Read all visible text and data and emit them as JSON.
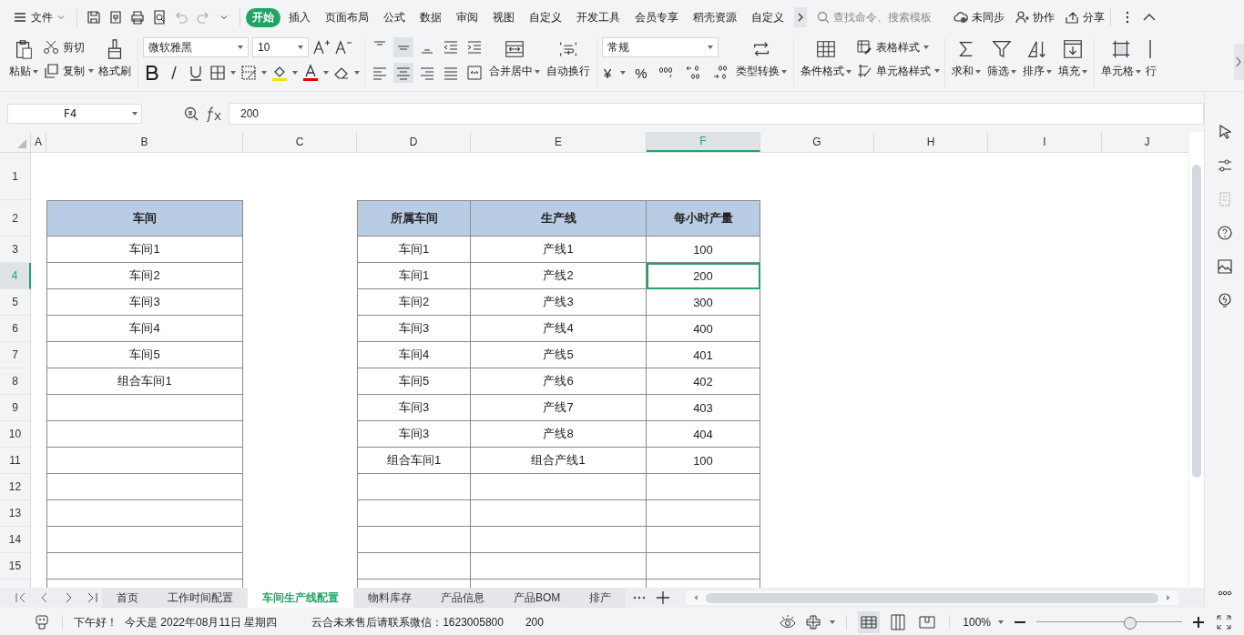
{
  "menu_bar": {
    "file_menu": "文件",
    "tabs": [
      {
        "label": "开始",
        "selected": true
      },
      {
        "label": "插入",
        "selected": false
      },
      {
        "label": "页面布局",
        "selected": false
      },
      {
        "label": "公式",
        "selected": false
      },
      {
        "label": "数据",
        "selected": false
      },
      {
        "label": "审阅",
        "selected": false
      },
      {
        "label": "视图",
        "selected": false
      },
      {
        "label": "自定义",
        "selected": false
      },
      {
        "label": "开发工具",
        "selected": false
      },
      {
        "label": "会员专享",
        "selected": false
      },
      {
        "label": "稻壳资源",
        "selected": false
      },
      {
        "label": "自定义",
        "selected": false
      }
    ],
    "search": {
      "placeholder": "查找命令、搜索模板"
    },
    "sync": "未同步",
    "collaborate": "协作",
    "share": "分享"
  },
  "ribbon": {
    "paste": "粘贴",
    "cut": "剪切",
    "copy": "复制",
    "format_painter": "格式刷",
    "font_name": "微软雅黑",
    "font_size": "10",
    "merge_center": "合并居中",
    "wrap_text": "自动换行",
    "number_format": "常规",
    "currency": "¥",
    "percent": "%",
    "type_convert": "类型转换",
    "conditional_format": "条件格式",
    "table_style": "表格样式",
    "cell_style": "单元格样式",
    "sum": "求和",
    "filter": "筛选",
    "sort": "排序",
    "fill": "填充",
    "cell": "单元格",
    "row": "行"
  },
  "formula_bar": {
    "name_box": "F4",
    "formula": "200"
  },
  "sheet": {
    "columns": [
      {
        "label": "A",
        "selected": false
      },
      {
        "label": "B",
        "selected": false
      },
      {
        "label": "C",
        "selected": false
      },
      {
        "label": "D",
        "selected": false
      },
      {
        "label": "E",
        "selected": false
      },
      {
        "label": "F",
        "selected": true
      },
      {
        "label": "G",
        "selected": false
      },
      {
        "label": "H",
        "selected": false
      },
      {
        "label": "I",
        "selected": false
      },
      {
        "label": "J",
        "selected": false
      }
    ],
    "rows": [
      {
        "label": "1",
        "selected": false
      },
      {
        "label": "2",
        "selected": false
      },
      {
        "label": "3",
        "selected": false
      },
      {
        "label": "4",
        "selected": true
      },
      {
        "label": "5",
        "selected": false
      },
      {
        "label": "6",
        "selected": false
      },
      {
        "label": "7",
        "selected": false
      },
      {
        "label": "8",
        "selected": false
      },
      {
        "label": "9",
        "selected": false
      },
      {
        "label": "10",
        "selected": false
      },
      {
        "label": "11",
        "selected": false
      },
      {
        "label": "12",
        "selected": false
      },
      {
        "label": "13",
        "selected": false
      },
      {
        "label": "14",
        "selected": false
      },
      {
        "label": "15",
        "selected": false
      }
    ]
  },
  "table_1": {
    "header": "车间",
    "rows": [
      "车间1",
      "车间2",
      "车间3",
      "车间4",
      "车间5",
      "组合车间1"
    ]
  },
  "table_2": {
    "columns": [
      "所属车间",
      "生产线",
      "每小时产量"
    ],
    "rows": [
      [
        {
          "text": "车间1",
          "selected": false
        },
        {
          "text": "产线1",
          "selected": false
        },
        {
          "text": "100",
          "selected": false
        }
      ],
      [
        {
          "text": "车间1",
          "selected": false
        },
        {
          "text": "产线2",
          "selected": false
        },
        {
          "text": "200",
          "selected": true
        }
      ],
      [
        {
          "text": "车间2",
          "selected": false
        },
        {
          "text": "产线3",
          "selected": false
        },
        {
          "text": "300",
          "selected": false
        }
      ],
      [
        {
          "text": "车间3",
          "selected": false
        },
        {
          "text": "产线4",
          "selected": false
        },
        {
          "text": "400",
          "selected": false
        }
      ],
      [
        {
          "text": "车间4",
          "selected": false
        },
        {
          "text": "产线5",
          "selected": false
        },
        {
          "text": "401",
          "selected": false
        }
      ],
      [
        {
          "text": "车间5",
          "selected": false
        },
        {
          "text": "产线6",
          "selected": false
        },
        {
          "text": "402",
          "selected": false
        }
      ],
      [
        {
          "text": "车间3",
          "selected": false
        },
        {
          "text": "产线7",
          "selected": false
        },
        {
          "text": "403",
          "selected": false
        }
      ],
      [
        {
          "text": "车间3",
          "selected": false
        },
        {
          "text": "产线8",
          "selected": false
        },
        {
          "text": "404",
          "selected": false
        }
      ],
      [
        {
          "text": "组合车间1",
          "selected": false
        },
        {
          "text": "组合产线1",
          "selected": false
        },
        {
          "text": "100",
          "selected": false
        }
      ]
    ]
  },
  "sheet_tabs": [
    {
      "label": "首页",
      "selected": false
    },
    {
      "label": "工作时间配置",
      "selected": false
    },
    {
      "label": "车间生产线配置",
      "selected": true
    },
    {
      "label": "物料库存",
      "selected": false
    },
    {
      "label": "产品信息",
      "selected": false
    },
    {
      "label": "产品BOM",
      "selected": false
    },
    {
      "label": "排产",
      "selected": false
    }
  ],
  "status_bar": {
    "greeting": "下午好！",
    "date": "今天是 2022年08月11日 星期四",
    "contact": "云合未来售后请联系微信：1623005800",
    "cell_value": "200",
    "zoom": "100%",
    "zoom_slider": {
      "level": 0.65
    }
  }
}
